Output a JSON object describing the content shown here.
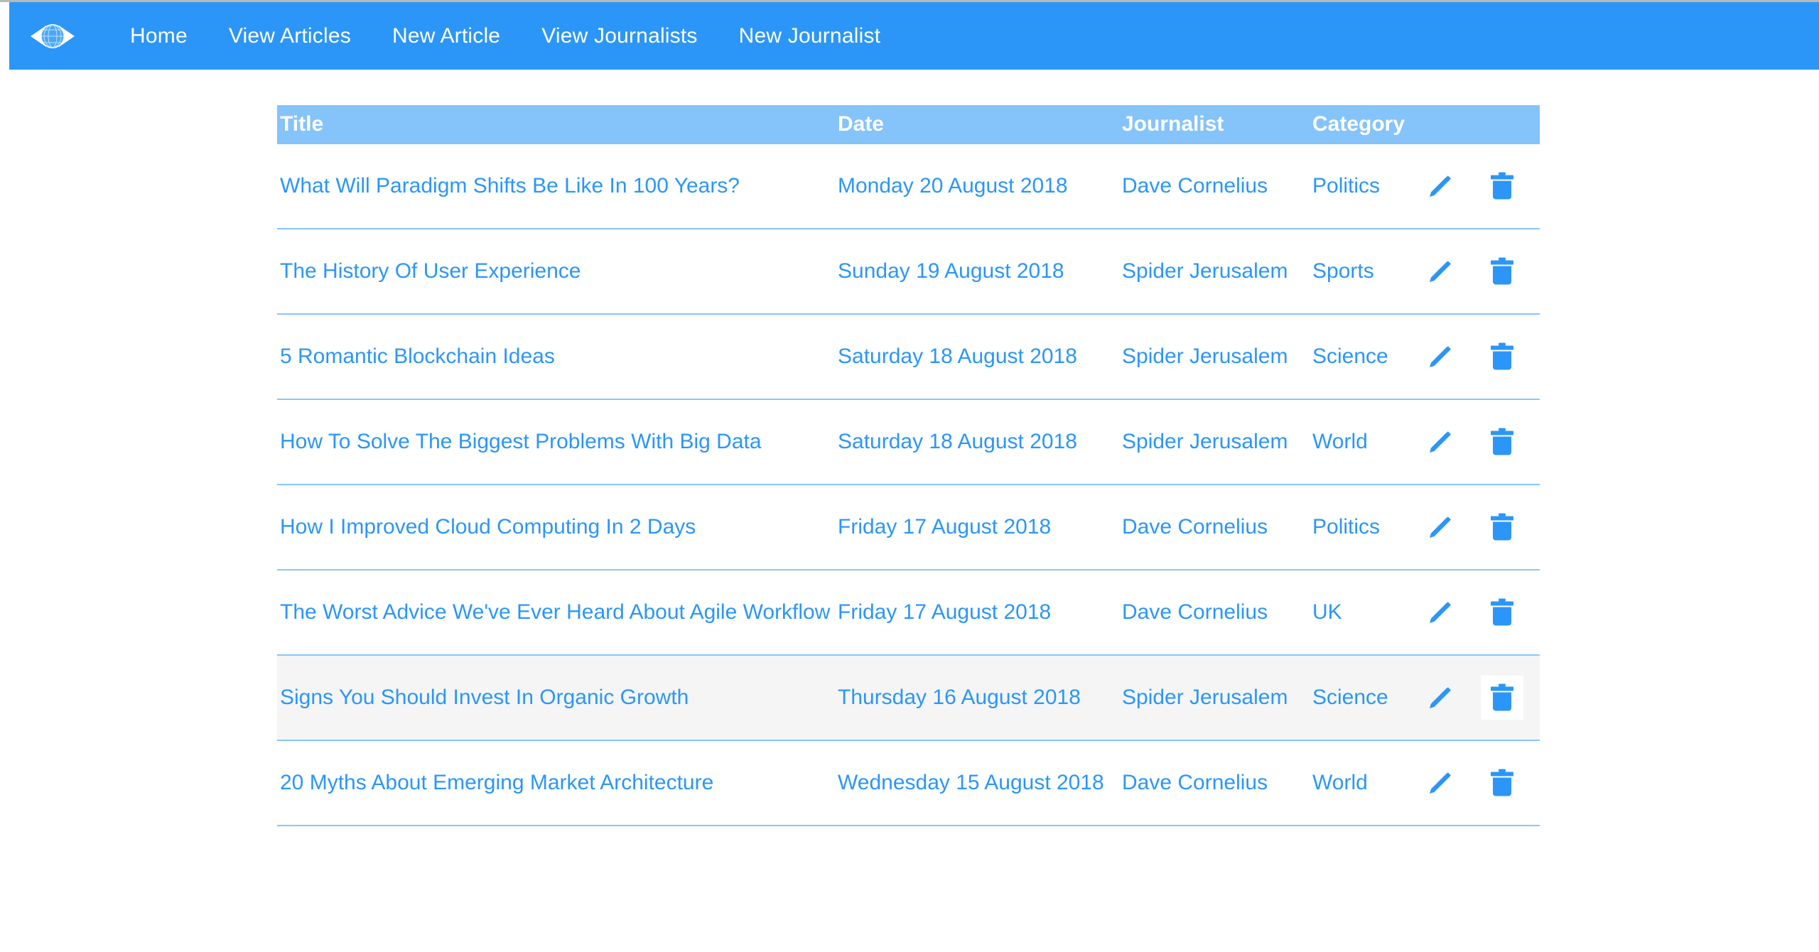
{
  "navbar": {
    "brand_icon": "globe-compass-logo",
    "links": [
      {
        "label": "Home"
      },
      {
        "label": "View Articles"
      },
      {
        "label": "New Article"
      },
      {
        "label": "View Journalists"
      },
      {
        "label": "New Journalist"
      }
    ],
    "background_color": "#2b96f7"
  },
  "table": {
    "header_background_color": "#85c3fb",
    "link_color": "#2b96f7",
    "row_border_color": "#8ac6fb",
    "hover_row_background": "#f5f5f5",
    "columns": [
      {
        "label": "Title"
      },
      {
        "label": "Date"
      },
      {
        "label": "Journalist"
      },
      {
        "label": "Category"
      },
      {
        "label": ""
      },
      {
        "label": ""
      }
    ],
    "edit_icon": "pencil-icon",
    "delete_icon": "trash-icon",
    "rows": [
      {
        "title": "What Will Paradigm Shifts Be Like In 100 Years?",
        "date": "Monday 20 August 2018",
        "journalist": "Dave Cornelius",
        "category": "Politics",
        "hovered": false,
        "delete_focused": false
      },
      {
        "title": "The History Of User Experience",
        "date": "Sunday 19 August 2018",
        "journalist": "Spider Jerusalem",
        "category": "Sports",
        "hovered": false,
        "delete_focused": false
      },
      {
        "title": "5 Romantic Blockchain Ideas",
        "date": "Saturday 18 August 2018",
        "journalist": "Spider Jerusalem",
        "category": "Science",
        "hovered": false,
        "delete_focused": false
      },
      {
        "title": "How To Solve The Biggest Problems With Big Data",
        "date": "Saturday 18 August 2018",
        "journalist": "Spider Jerusalem",
        "category": "World",
        "hovered": false,
        "delete_focused": false
      },
      {
        "title": "How I Improved Cloud Computing In 2 Days",
        "date": "Friday 17 August 2018",
        "journalist": "Dave Cornelius",
        "category": "Politics",
        "hovered": false,
        "delete_focused": false
      },
      {
        "title": "The Worst Advice We've Ever Heard About Agile Workflow",
        "date": "Friday 17 August 2018",
        "journalist": "Dave Cornelius",
        "category": "UK",
        "hovered": false,
        "delete_focused": false
      },
      {
        "title": "Signs You Should Invest In Organic Growth",
        "date": "Thursday 16 August 2018",
        "journalist": "Spider Jerusalem",
        "category": "Science",
        "hovered": true,
        "delete_focused": true
      },
      {
        "title": "20 Myths About Emerging Market Architecture",
        "date": "Wednesday 15 August 2018",
        "journalist": "Dave Cornelius",
        "category": "World",
        "hovered": false,
        "delete_focused": false
      }
    ]
  }
}
